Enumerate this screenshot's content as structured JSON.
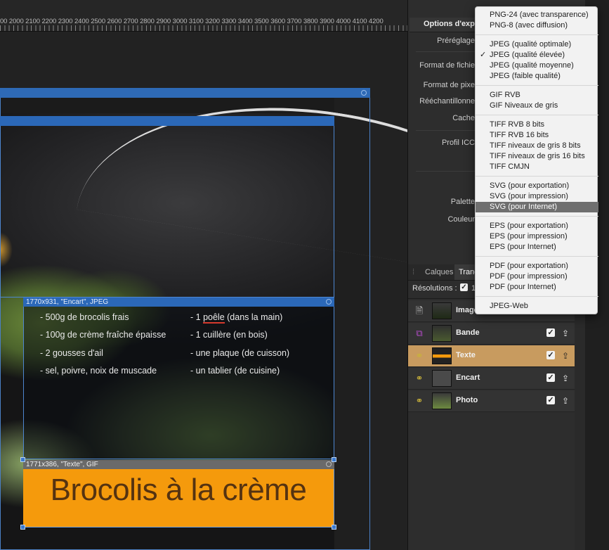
{
  "ruler": {
    "numbers": "00 2000 2100 2200 2300 2400 2500 2600 2700 2800 2900 3000 3100 3200 3300 3400 3500 3600 3700 3800 3900 4000 4100 4200"
  },
  "slices": {
    "encart_label": "1770x931, \"Encart\", JPEG",
    "texte_label": "1771x386, \"Texte\", GIF"
  },
  "recipe": {
    "left": [
      "- 500g de brocolis frais",
      "- 100g de crème fraîche épaisse",
      "- 2 gousses d'ail",
      "- sel, poivre, noix de muscade"
    ],
    "right": [
      "- 1 ",
      "poêle",
      " (dans la main)",
      "- 1 cuillère (en bois)",
      "- une plaque (de cuisson)",
      "- un tablier (de cuisine)"
    ]
  },
  "band": {
    "title": "Brocolis à la crème"
  },
  "export_panel": {
    "title": "Options d'expo",
    "labels": [
      "Préréglage",
      "Format de fichie",
      "Format de pixe",
      "Rééchantillonne",
      "Cache",
      "Profil ICC",
      "Palette",
      "Couleur"
    ]
  },
  "layers": {
    "tabs": [
      "Calques",
      "Tranc"
    ],
    "resolution_label": "Résolutions :",
    "resolution_value": "1",
    "rows": [
      {
        "name": "Image",
        "icon": "document-icon",
        "check": "",
        "share": ""
      },
      {
        "name": "Bande",
        "icon": "artboard-icon",
        "check": "✓",
        "share": "⇪"
      },
      {
        "name": "Texte",
        "icon": "slice-icon",
        "check": "✓",
        "share": "⇪"
      },
      {
        "name": "Encart",
        "icon": "slice-icon",
        "check": "✓",
        "share": "⇪"
      },
      {
        "name": "Photo",
        "icon": "slice-icon",
        "check": "✓",
        "share": "⇪"
      }
    ]
  },
  "dropdown": {
    "groups": [
      [
        "PNG-24 (avec transparence)",
        "PNG-8 (avec diffusion)"
      ],
      [
        "JPEG (qualité optimale)",
        "JPEG (qualité élevée)",
        "JPEG (qualité moyenne)",
        "JPEG (faible qualité)"
      ],
      [
        "GIF RVB",
        "GIF Niveaux de gris"
      ],
      [
        "TIFF RVB 8 bits",
        "TIFF RVB 16 bits",
        "TIFF niveaux de gris 8 bits",
        "TIFF niveaux de gris 16 bits",
        "TIFF CMJN"
      ],
      [
        "SVG (pour exportation)",
        "SVG (pour impression)",
        "SVG (pour Internet)"
      ],
      [
        "EPS (pour exportation)",
        "EPS (pour impression)",
        "EPS (pour Internet)"
      ],
      [
        "PDF (pour exportation)",
        "PDF (pour impression)",
        "PDF (pour Internet)"
      ],
      [
        "JPEG-Web"
      ]
    ],
    "checked": "JPEG (qualité élevée)",
    "highlighted": "SVG (pour Internet)",
    "check_glyph": "✓"
  }
}
